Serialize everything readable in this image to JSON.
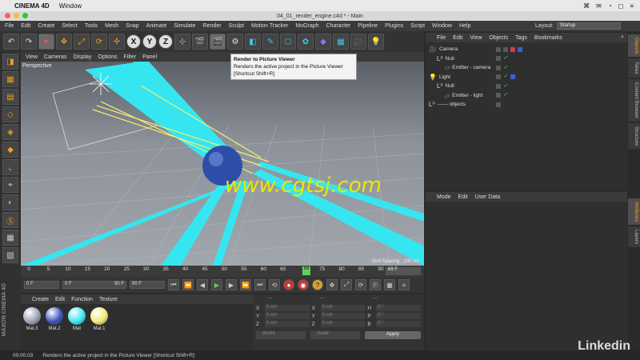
{
  "mac": {
    "app": "CINEMA 4D",
    "menu": "Window",
    "right": [
      "⌘",
      "✉",
      "Wi-Fi",
      "◻",
      "≡"
    ]
  },
  "window": {
    "title": "04_01_render_engine.c4d * - Main"
  },
  "menubar": {
    "items": [
      "File",
      "Edit",
      "Create",
      "Select",
      "Tools",
      "Mesh",
      "Snap",
      "Animate",
      "Simulate",
      "Render",
      "Sculpt",
      "Motion Tracker",
      "MoGraph",
      "Character",
      "Pipeline",
      "Plugins",
      "Script",
      "Window",
      "Help"
    ],
    "layout_label": "Layout:",
    "layout_value": "Startup"
  },
  "toolbar": {
    "icons": [
      "undo-icon",
      "redo-icon",
      "select-icon",
      "move-icon",
      "scale-icon",
      "rotate-icon",
      "transform-icon",
      "x-axis",
      "y-axis",
      "z-axis",
      "coords-icon",
      "render-view-icon",
      "render-picture-viewer-icon",
      "render-settings-icon",
      "cube-icon",
      "pen-icon",
      "subdivision-icon",
      "array-icon",
      "deformer-icon",
      "floor-icon",
      "camera-icon",
      "light-icon"
    ],
    "x": "X",
    "y": "Y",
    "z": "Z"
  },
  "viewport": {
    "menu": [
      "View",
      "Cameras",
      "Display",
      "Options",
      "Filter",
      "Panel"
    ],
    "label": "Perspective",
    "grid_label": "Grid Spacing : 100 cm",
    "watermark": "www.cgtsj.com"
  },
  "tooltip": {
    "title": "Render to Picture Viewer",
    "line1": "Renders the active project in the Picture Viewer",
    "line2": "[Shortcut Shift+R]"
  },
  "timeline": {
    "ticks": [
      "0",
      "5",
      "10",
      "15",
      "20",
      "25",
      "30",
      "35",
      "40",
      "45",
      "50",
      "55",
      "60",
      "65",
      "69",
      "75",
      "80",
      "85",
      "90"
    ],
    "current": "69",
    "end_field": "69 F"
  },
  "transport": {
    "start": "0 F",
    "range_start": "0 F",
    "range_end": "90 F",
    "end": "90 F"
  },
  "materials": {
    "menu": [
      "Create",
      "Edit",
      "Function",
      "Texture"
    ],
    "items": [
      {
        "name": "Mat.3",
        "color": "#9aa3b5"
      },
      {
        "name": "Mat.2",
        "color": "#3f56b8"
      },
      {
        "name": "Mat",
        "color": "#3de8f0"
      },
      {
        "name": "Mat.1",
        "color": "#f0ec7a"
      }
    ]
  },
  "coords": {
    "headers": [
      "---",
      "---",
      "---"
    ],
    "rows": [
      {
        "a1": "X",
        "v1": "0 cm",
        "a2": "X",
        "v2": "0 cm",
        "a3": "H",
        "v3": "0 °"
      },
      {
        "a1": "Y",
        "v1": "0 cm",
        "a2": "Y",
        "v2": "0 cm",
        "a3": "P",
        "v3": "0 °"
      },
      {
        "a1": "Z",
        "v1": "0 cm",
        "a2": "Z",
        "v2": "0 cm",
        "a3": "B",
        "v3": "0 °"
      }
    ],
    "mode1": "World",
    "mode2": "Scale",
    "apply": "Apply"
  },
  "objects": {
    "menu": [
      "File",
      "Edit",
      "View",
      "Objects",
      "Tags",
      "Bookmarks"
    ],
    "rows": [
      {
        "name": "Camera",
        "indent": 0
      },
      {
        "name": "Null",
        "indent": 1
      },
      {
        "name": "Emitter - camera",
        "indent": 2
      },
      {
        "name": "Light",
        "indent": 0
      },
      {
        "name": "Null",
        "indent": 1
      },
      {
        "name": "Emitter - light",
        "indent": 2
      },
      {
        "name": "------ objects",
        "indent": 0
      }
    ]
  },
  "attributes": {
    "menu": [
      "Mode",
      "Edit",
      "User Data"
    ]
  },
  "right_tabs": [
    "Objects",
    "Takes",
    "Content Browser",
    "Structure",
    "Attributes",
    "Layers"
  ],
  "status": {
    "time": "00:00:03",
    "message": "Renders the active project in the Picture Viewer [Shortcut Shift+R]"
  },
  "brand": "Linkedin"
}
